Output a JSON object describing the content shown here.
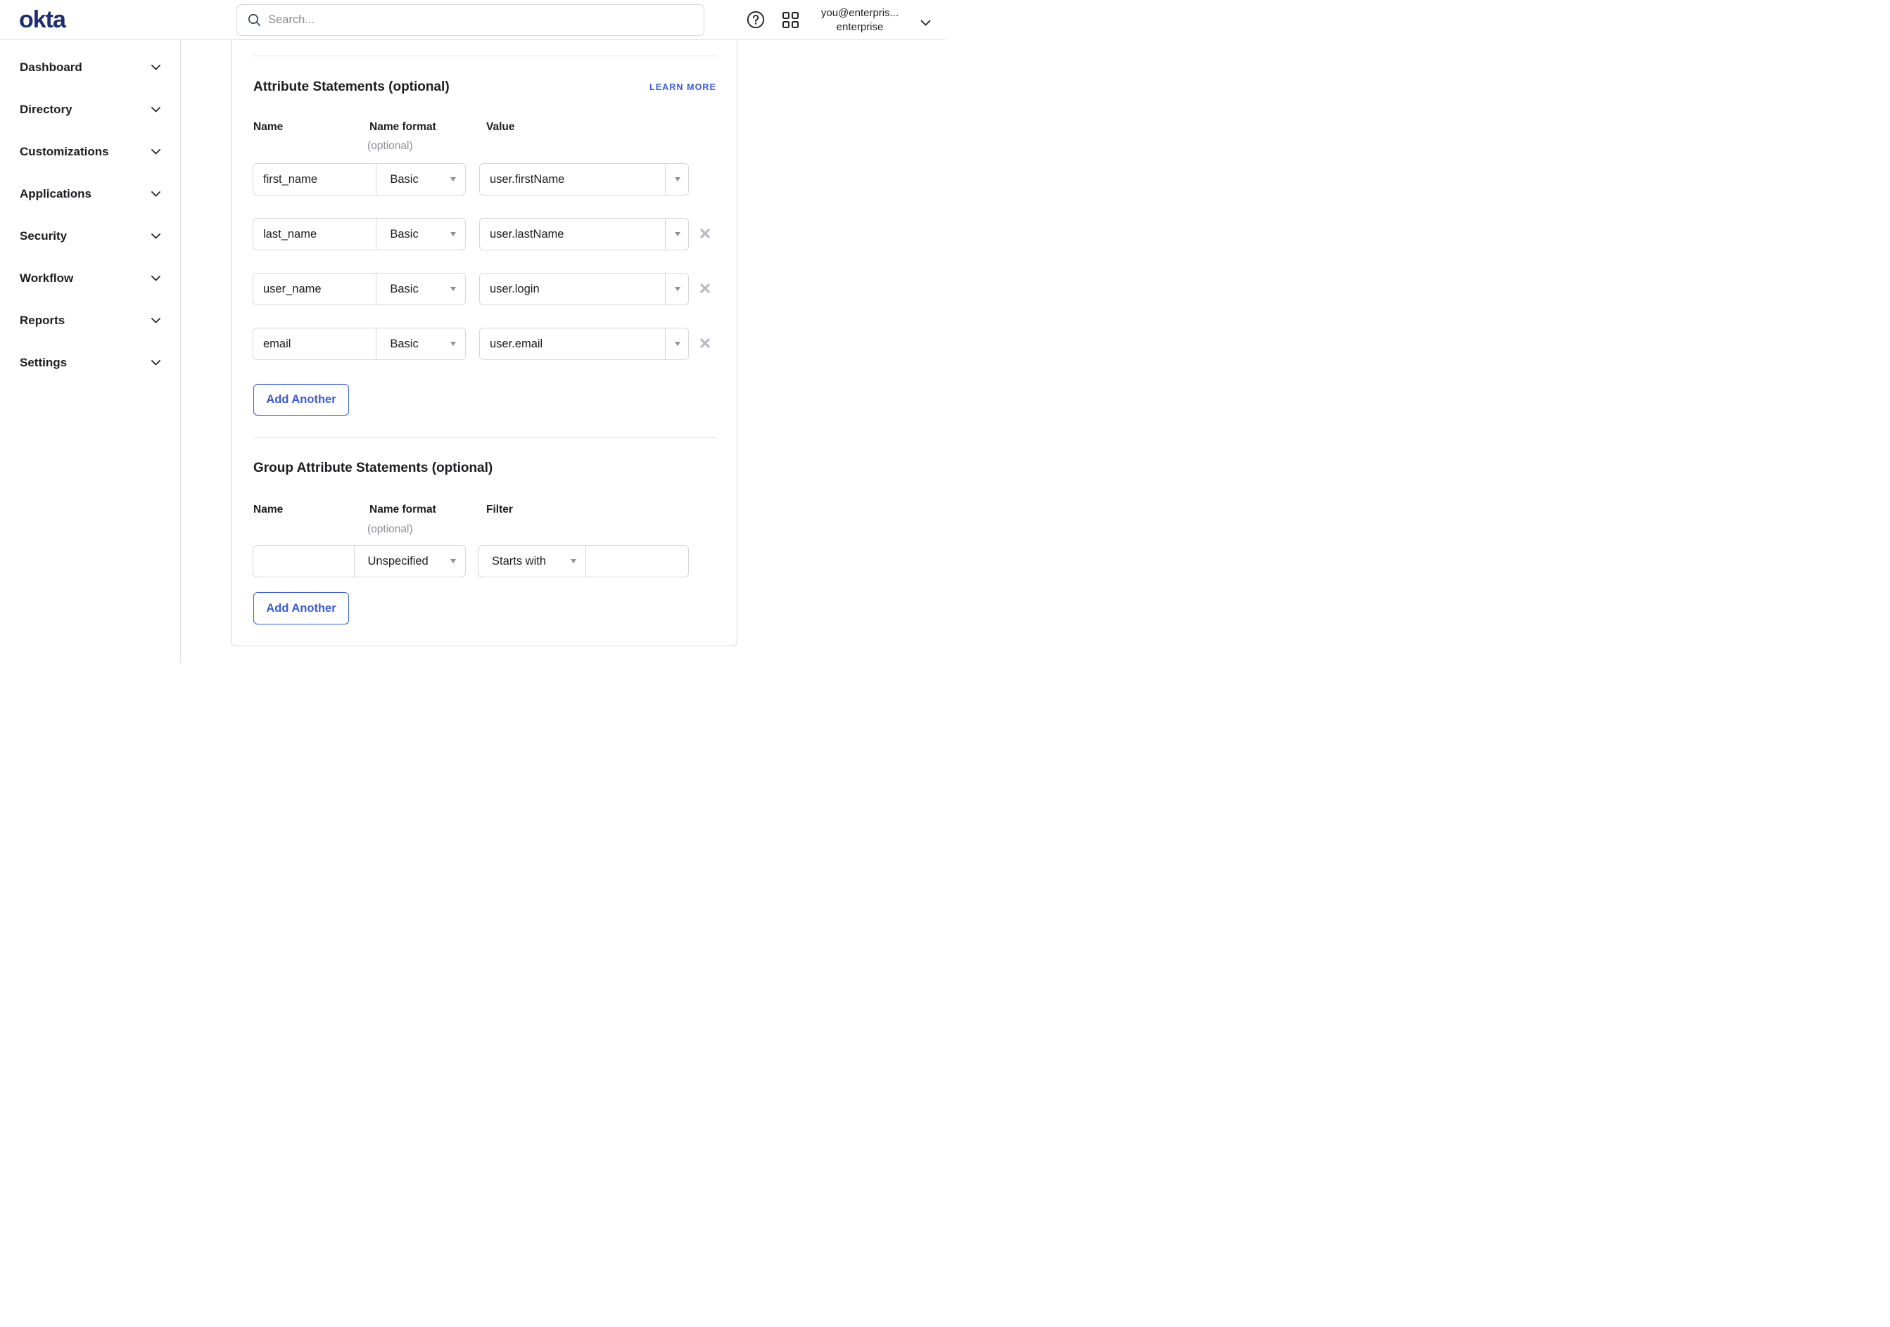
{
  "brand": {
    "logo_text": "okta"
  },
  "topbar": {
    "search_placeholder": "Search...",
    "account_line1": "you@enterpris...",
    "account_line2": "enterprise"
  },
  "sidebar": {
    "items": [
      {
        "label": "Dashboard"
      },
      {
        "label": "Directory"
      },
      {
        "label": "Customizations"
      },
      {
        "label": "Applications"
      },
      {
        "label": "Security"
      },
      {
        "label": "Workflow"
      },
      {
        "label": "Reports"
      },
      {
        "label": "Settings"
      }
    ]
  },
  "attribute_section": {
    "title": "Attribute Statements (optional)",
    "learn_more_label": "LEARN MORE",
    "columns": {
      "name": "Name",
      "format": "Name format",
      "format_note": "(optional)",
      "value": "Value"
    },
    "rows": [
      {
        "name": "first_name",
        "format": "Basic",
        "value": "user.firstName"
      },
      {
        "name": "last_name",
        "format": "Basic",
        "value": "user.lastName"
      },
      {
        "name": "user_name",
        "format": "Basic",
        "value": "user.login"
      },
      {
        "name": "email",
        "format": "Basic",
        "value": "user.email"
      }
    ],
    "add_button_label": "Add Another"
  },
  "group_section": {
    "title": "Group Attribute Statements (optional)",
    "columns": {
      "name": "Name",
      "format": "Name format",
      "format_note": "(optional)",
      "filter": "Filter"
    },
    "row": {
      "name": "",
      "format": "Unspecified",
      "filter": "Starts with",
      "filter_value": ""
    },
    "add_button_label": "Add Another"
  },
  "colors": {
    "accent_blue": "#3a5bd9",
    "logo_navy": "#1c2f73"
  }
}
